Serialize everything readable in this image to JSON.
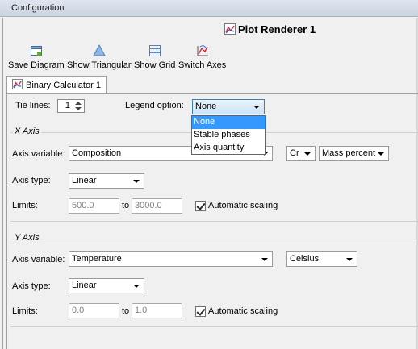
{
  "window": {
    "title": "Configuration"
  },
  "plot": {
    "title": "Plot Renderer 1"
  },
  "toolbar": {
    "save_label": "Save Diagram",
    "triangular_label": "Show Triangular",
    "grid_label": "Show Grid",
    "switch_label": "Switch Axes"
  },
  "tab": {
    "label": "Binary Calculator 1"
  },
  "tie_lines": {
    "label": "Tie lines:",
    "value": "1"
  },
  "legend_option": {
    "label": "Legend option:",
    "value": "None",
    "options": [
      "None",
      "Stable phases",
      "Axis quantity"
    ]
  },
  "x_axis": {
    "title": "X Axis",
    "variable_label": "Axis variable:",
    "variable": "Composition",
    "element": "Cr",
    "unit": "Mass percent",
    "type_label": "Axis type:",
    "type": "Linear",
    "limits_label": "Limits:",
    "min": "500.0",
    "to": "to",
    "max": "3000.0",
    "auto_label": "Automatic scaling",
    "auto_checked": true
  },
  "y_axis": {
    "title": "Y Axis",
    "variable_label": "Axis variable:",
    "variable": "Temperature",
    "unit": "Celsius",
    "type_label": "Axis type:",
    "type": "Linear",
    "limits_label": "Limits:",
    "min": "0.0",
    "to": "to",
    "max": "1.0",
    "auto_label": "Automatic scaling",
    "auto_checked": true
  },
  "icons": {
    "plot": "chart-icon",
    "save": "save-diagram-icon",
    "triangular": "triangle-icon",
    "grid": "grid-icon",
    "switch": "switch-axes-icon"
  }
}
